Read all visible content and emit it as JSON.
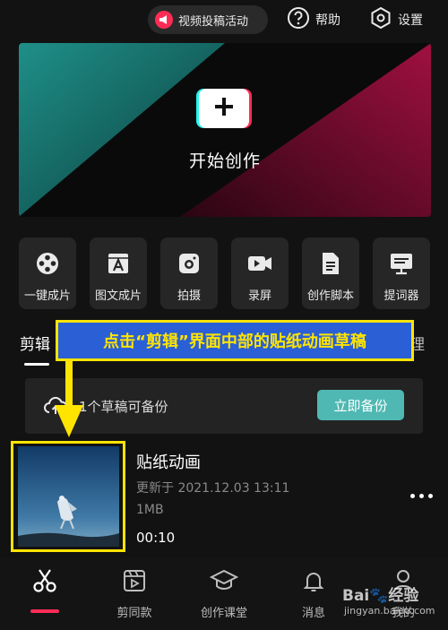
{
  "topbar": {
    "promo_label": "视频投稿活动",
    "help_label": "帮助",
    "settings_label": "设置"
  },
  "hero": {
    "label": "开始创作"
  },
  "tools": [
    {
      "label": "一键成片",
      "icon": "film-reel-icon"
    },
    {
      "label": "图文成片",
      "icon": "text-card-icon"
    },
    {
      "label": "拍摄",
      "icon": "camera-icon"
    },
    {
      "label": "录屏",
      "icon": "screen-record-icon"
    },
    {
      "label": "创作脚本",
      "icon": "script-doc-icon"
    },
    {
      "label": "提词器",
      "icon": "teleprompter-icon"
    }
  ],
  "tabs": {
    "left": "剪辑",
    "right": "理"
  },
  "annotation": {
    "callout": "点击“剪辑”界面中部的贴纸动画草稿"
  },
  "backup": {
    "text": "1个草稿可备份",
    "button": "立即备份"
  },
  "draft": {
    "title": "贴纸动画",
    "updated": "更新于 2021.12.03 13:11",
    "size": "1MB",
    "duration": "00:10"
  },
  "bottom_nav": [
    {
      "label": "",
      "icon": "scissors-icon",
      "active": true
    },
    {
      "label": "剪同款",
      "icon": "template-play-icon"
    },
    {
      "label": "创作课堂",
      "icon": "graduation-cap-icon"
    },
    {
      "label": "消息",
      "icon": "bell-icon"
    },
    {
      "label": "我的",
      "icon": "profile-icon"
    }
  ],
  "watermark": {
    "main": "Bai🐾经验",
    "sub": "jingyan.baidu.com"
  },
  "colors": {
    "accent_red": "#fe2c55",
    "accent_cyan": "#25f4ee",
    "backup_button": "#4fb8b2",
    "annotation_yellow": "#ffe400",
    "annotation_blue": "#2a5fd6"
  }
}
